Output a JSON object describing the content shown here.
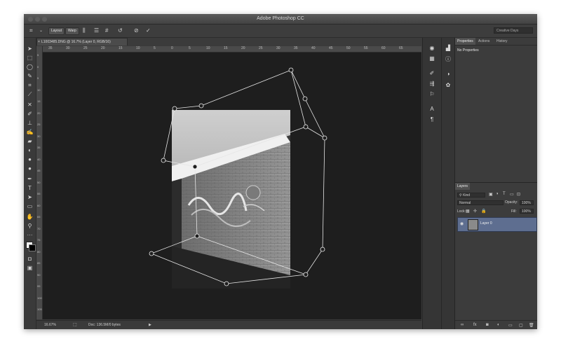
{
  "app": {
    "title": "Adobe Photoshop CC"
  },
  "options_bar": {
    "layout_label": "Layout",
    "warp_label": "Warp",
    "workspace": "Creative Days"
  },
  "document": {
    "tab_title": "L1003485.DNG @ 16.7% (Layer 0, RGB/16)",
    "ruler_top": [
      "35",
      "30",
      "25",
      "20",
      "15",
      "10",
      "5",
      "0",
      "5",
      "10",
      "15",
      "20",
      "25",
      "30",
      "35",
      "40",
      "45",
      "50",
      "55",
      "60",
      "65"
    ],
    "ruler_left": [
      "5",
      "0",
      "5",
      "10",
      "15",
      "20",
      "25",
      "30",
      "35",
      "40",
      "45",
      "50",
      "55",
      "60",
      "65",
      "70",
      "75",
      "80",
      "85",
      "90",
      "95",
      "100",
      "105"
    ]
  },
  "status": {
    "zoom": "16.67%",
    "doc_info": "Doc: 136.5M/0 bytes"
  },
  "properties": {
    "tabs": [
      "Properties",
      "Actions",
      "History"
    ],
    "empty_message": "No Properties"
  },
  "layers": {
    "tab": "Layers",
    "filter_kind": "Kind",
    "blend_mode": "Normal",
    "opacity_label": "Opacity:",
    "opacity_value": "100%",
    "lock_label": "Lock:",
    "fill_label": "Fill:",
    "fill_value": "100%",
    "items": [
      {
        "name": "Layer 0",
        "selected": true
      }
    ]
  },
  "icons": {
    "toolbar": [
      "move-icon",
      "marquee-icon",
      "lasso-icon",
      "quick-select-icon",
      "crop-icon",
      "eyedropper-icon",
      "healing-icon",
      "brush-icon",
      "stamp-icon",
      "history-brush-icon",
      "eraser-icon",
      "gradient-icon",
      "blur-icon",
      "dodge-icon",
      "pen-icon",
      "type-icon",
      "path-select-icon",
      "rectangle-icon",
      "hand-icon",
      "zoom-icon"
    ]
  }
}
